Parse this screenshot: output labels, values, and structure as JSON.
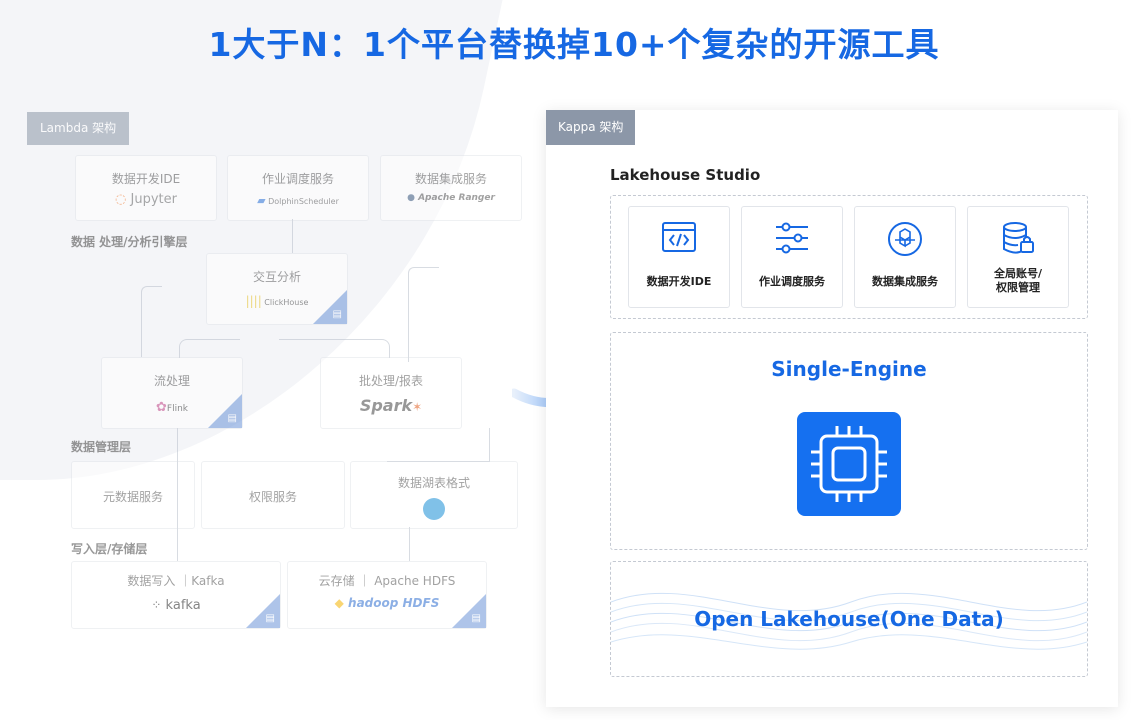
{
  "title": "1大于N：1个平台替换掉10+个复杂的开源工具",
  "lambda": {
    "tag": "Lambda 架构",
    "top_boxes": [
      {
        "label": "数据开发IDE",
        "logo": "Jupyter",
        "icon": "jupyter-logo"
      },
      {
        "label": "作业调度服务",
        "logo": "DolphinScheduler",
        "icon": "dolphinscheduler-logo"
      },
      {
        "label": "数据集成服务",
        "logo": "Apache Ranger",
        "icon": "apache-ranger-logo"
      }
    ],
    "section_engine": "数据 处理/分析引擎层",
    "interactive": {
      "label": "交互分析",
      "logo": "ClickHouse"
    },
    "stream": {
      "label": "流处理",
      "logo": "Flink"
    },
    "batch": {
      "label": "批处理/报表",
      "logo": "Spark"
    },
    "section_manage": "数据管理层",
    "manage_boxes": [
      {
        "label": "元数据服务"
      },
      {
        "label": "权限服务"
      },
      {
        "label": "数据湖表格式"
      }
    ],
    "section_storage": "写入层/存储层",
    "ingest": {
      "label": "数据写入 ｜Kafka",
      "logo": "kafka"
    },
    "storage": {
      "label": "云存储 ｜ Apache HDFS",
      "logo": "hadoop HDFS"
    }
  },
  "kappa": {
    "tag": "Kappa 架构",
    "studio_title": "Lakehouse  Studio",
    "cards": [
      {
        "label": "数据开发IDE",
        "icon": "code-window-icon"
      },
      {
        "label": "作业调度服务",
        "icon": "sliders-icon"
      },
      {
        "label": "数据集成服务",
        "icon": "cubes-icon"
      },
      {
        "label": "全局账号/\n权限管理",
        "icon": "database-lock-icon"
      }
    ],
    "engine_title": "Single-Engine",
    "engine_icon": "chip-icon",
    "lake_title": "Open Lakehouse(One Data)"
  },
  "colors": {
    "accent": "#1668e3",
    "chip": "#1570f0",
    "tag": "#8c97a8"
  }
}
